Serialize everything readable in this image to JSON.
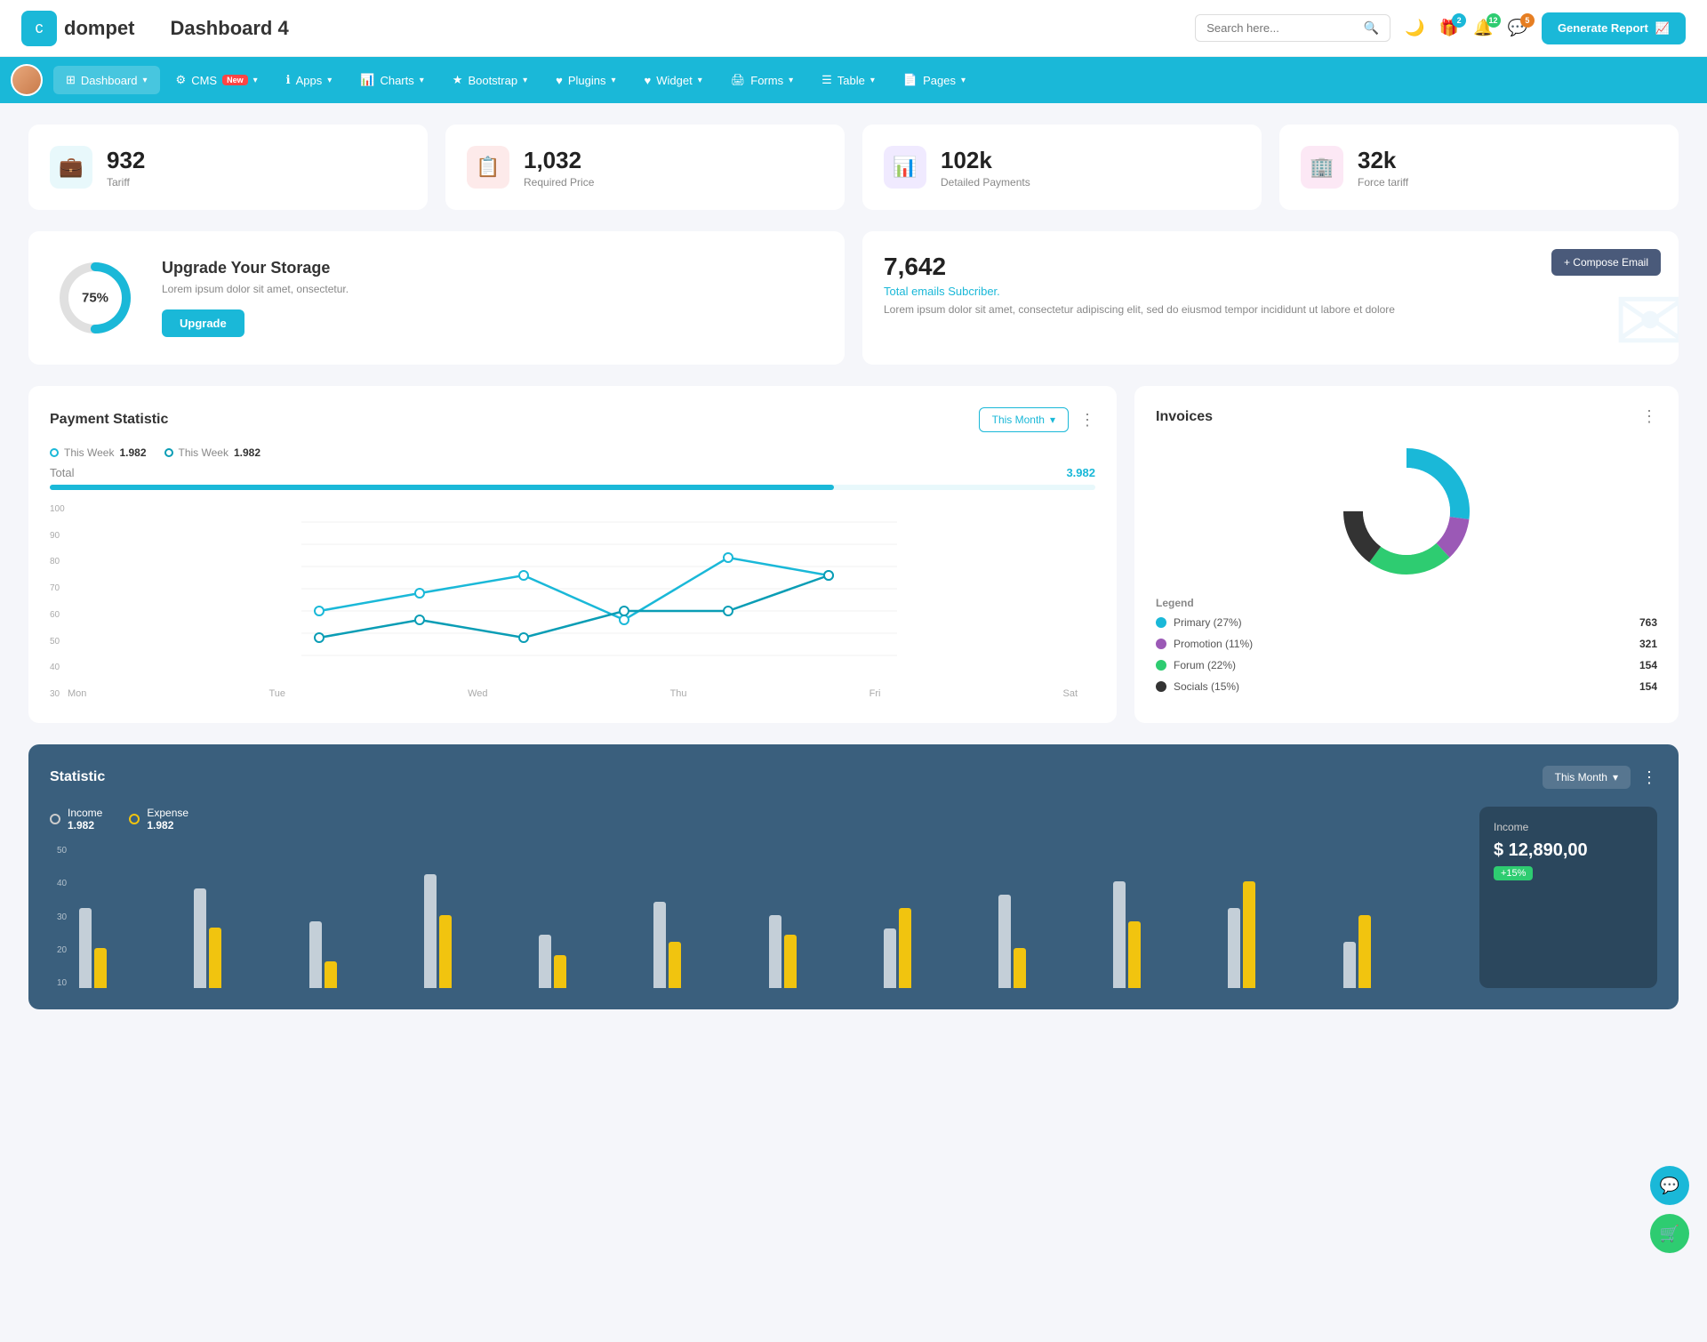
{
  "app": {
    "logo_text": "dompet",
    "page_title": "Dashboard 4",
    "search_placeholder": "Search here...",
    "generate_btn": "Generate Report"
  },
  "header_icons": {
    "badges": {
      "gift": "2",
      "bell": "12",
      "chat": "5"
    }
  },
  "nav": {
    "items": [
      {
        "id": "dashboard",
        "label": "Dashboard",
        "active": true,
        "has_arrow": true
      },
      {
        "id": "cms",
        "label": "CMS",
        "active": false,
        "has_arrow": true,
        "badge": "New"
      },
      {
        "id": "apps",
        "label": "Apps",
        "active": false,
        "has_arrow": true
      },
      {
        "id": "charts",
        "label": "Charts",
        "active": false,
        "has_arrow": true
      },
      {
        "id": "bootstrap",
        "label": "Bootstrap",
        "active": false,
        "has_arrow": true
      },
      {
        "id": "plugins",
        "label": "Plugins",
        "active": false,
        "has_arrow": true
      },
      {
        "id": "widget",
        "label": "Widget",
        "active": false,
        "has_arrow": true
      },
      {
        "id": "forms",
        "label": "Forms",
        "active": false,
        "has_arrow": true
      },
      {
        "id": "table",
        "label": "Table",
        "active": false,
        "has_arrow": true
      },
      {
        "id": "pages",
        "label": "Pages",
        "active": false,
        "has_arrow": true
      }
    ]
  },
  "stat_cards": [
    {
      "id": "tariff",
      "value": "932",
      "label": "Tariff",
      "icon": "💼",
      "color": "teal"
    },
    {
      "id": "required-price",
      "value": "1,032",
      "label": "Required Price",
      "icon": "📋",
      "color": "red"
    },
    {
      "id": "detailed-payments",
      "value": "102k",
      "label": "Detailed Payments",
      "icon": "📊",
      "color": "purple"
    },
    {
      "id": "force-tariff",
      "value": "32k",
      "label": "Force tariff",
      "icon": "🏢",
      "color": "pink"
    }
  ],
  "storage": {
    "percent": "75%",
    "title": "Upgrade Your Storage",
    "description": "Lorem ipsum dolor sit amet, onsectetur.",
    "button_label": "Upgrade"
  },
  "email": {
    "count": "7,642",
    "subtitle": "Total emails Subcriber.",
    "description": "Lorem ipsum dolor sit amet, consectetur adipiscing elit, sed do eiusmod tempor incididunt ut labore et dolore",
    "compose_btn": "+ Compose Email"
  },
  "payment": {
    "title": "Payment Statistic",
    "this_month_label": "This Month",
    "legends": [
      {
        "label": "This Week",
        "value": "1.982",
        "type": "outline-teal"
      },
      {
        "label": "This Week",
        "value": "1.982",
        "type": "outline-dark-teal"
      }
    ],
    "total_label": "Total",
    "total_value": "3.982",
    "x_axis": [
      "Mon",
      "Tue",
      "Wed",
      "Thu",
      "Fri",
      "Sat"
    ],
    "y_axis": [
      "100",
      "90",
      "80",
      "70",
      "60",
      "50",
      "40",
      "30"
    ]
  },
  "invoices": {
    "title": "Invoices",
    "legend": [
      {
        "label": "Primary (27%)",
        "color": "#1ab8d8",
        "count": "763"
      },
      {
        "label": "Promotion (11%)",
        "color": "#9b59b6",
        "count": "321"
      },
      {
        "label": "Forum (22%)",
        "color": "#2ecc71",
        "count": "154"
      },
      {
        "label": "Socials (15%)",
        "color": "#333",
        "count": "154"
      }
    ]
  },
  "statistic": {
    "title": "Statistic",
    "this_month_label": "This Month",
    "income_label": "Income",
    "income_value": "1.982",
    "expense_label": "Expense",
    "expense_value": "1.982",
    "income_panel": {
      "title": "Income",
      "amount": "$ 12,890,00",
      "badge": "+15%"
    },
    "y_axis": [
      "50",
      "40",
      "30",
      "20",
      "10"
    ],
    "bar_data": [
      {
        "white": 60,
        "yellow": 30
      },
      {
        "white": 75,
        "yellow": 45
      },
      {
        "white": 50,
        "yellow": 20
      },
      {
        "white": 85,
        "yellow": 55
      },
      {
        "white": 40,
        "yellow": 25
      },
      {
        "white": 65,
        "yellow": 35
      },
      {
        "white": 55,
        "yellow": 40
      },
      {
        "white": 45,
        "yellow": 60
      },
      {
        "white": 70,
        "yellow": 30
      },
      {
        "white": 80,
        "yellow": 50
      },
      {
        "white": 60,
        "yellow": 80
      },
      {
        "white": 35,
        "yellow": 55
      }
    ]
  },
  "float_btns": {
    "support": "💬",
    "cart": "🛒"
  }
}
